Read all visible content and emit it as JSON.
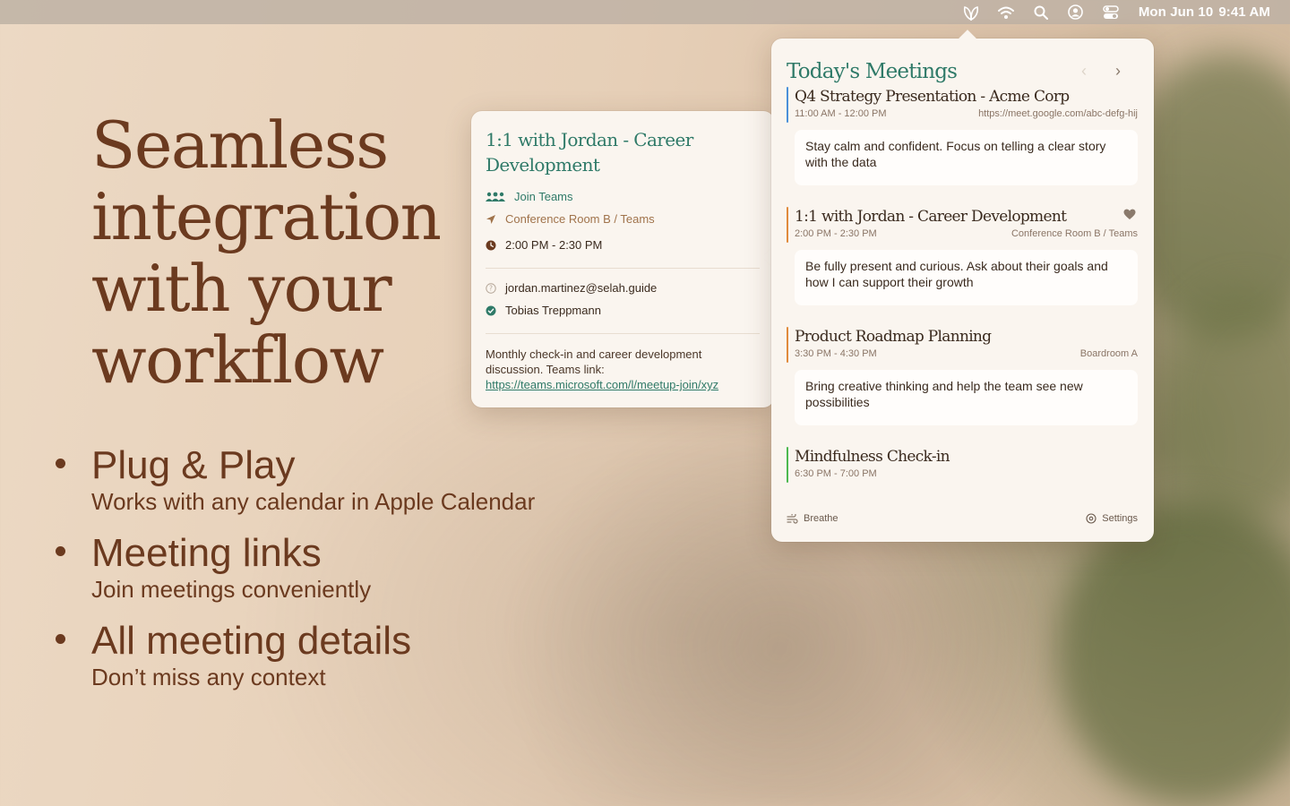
{
  "menubar": {
    "icons": [
      "leaf-app-icon",
      "wifi-icon",
      "search-icon",
      "user-icon",
      "control-center-icon"
    ],
    "date": "Mon Jun 10",
    "time": "9:41 AM"
  },
  "hero": {
    "title": "Seamless integration with your workflow",
    "features": [
      {
        "title": "Plug & Play",
        "subtitle": "Works with any calendar in Apple Calendar"
      },
      {
        "title": "Meeting links",
        "subtitle": "Join meetings conveniently"
      },
      {
        "title": "All meeting details",
        "subtitle": "Don’t miss any context"
      }
    ]
  },
  "detail": {
    "title": "1:1 with Jordan - Career Development",
    "join_label": "Join Teams",
    "location": "Conference Room B / Teams",
    "time": "2:00 PM - 2:30 PM",
    "attendees": [
      {
        "email": "jordan.martinez@selah.guide",
        "status": "unknown"
      },
      {
        "email": "Tobias Treppmann",
        "status": "accepted"
      }
    ],
    "description": "Monthly check-in and career development discussion. Teams link: ",
    "link_text": "https://teams.microsoft.com/l/meetup-join/xyz",
    "colors": {
      "accent": "#2f7a68",
      "location": "#a0734b"
    }
  },
  "panel": {
    "title": "Today's Meetings",
    "prev": "‹",
    "next": "›",
    "meetings": [
      {
        "title": "Q4 Strategy Presentation - Acme Corp",
        "time": "11:00 AM - 12:00 PM",
        "location": "https://meet.google.com/abc-defg-hij",
        "note": "Stay calm and confident. Focus on telling a clear story with the data",
        "color": "#4a90d9"
      },
      {
        "title": "1:1 with Jordan - Career Development",
        "time": "2:00 PM - 2:30 PM",
        "location": "Conference Room B / Teams",
        "note": "Be fully present and curious. Ask about their goals and how I can support their growth",
        "color": "#e08a3c"
      },
      {
        "title": "Product Roadmap Planning",
        "time": "3:30 PM - 4:30 PM",
        "location": "Boardroom A",
        "note": "Bring creative thinking and help the team see new possibilities",
        "color": "#e08a3c"
      },
      {
        "title": "Mindfulness Check-in",
        "time": "6:30 PM - 7:00 PM",
        "location": "",
        "note": "",
        "color": "#4cb84f"
      }
    ],
    "footer": {
      "breathe": "Breathe",
      "settings": "Settings"
    }
  }
}
